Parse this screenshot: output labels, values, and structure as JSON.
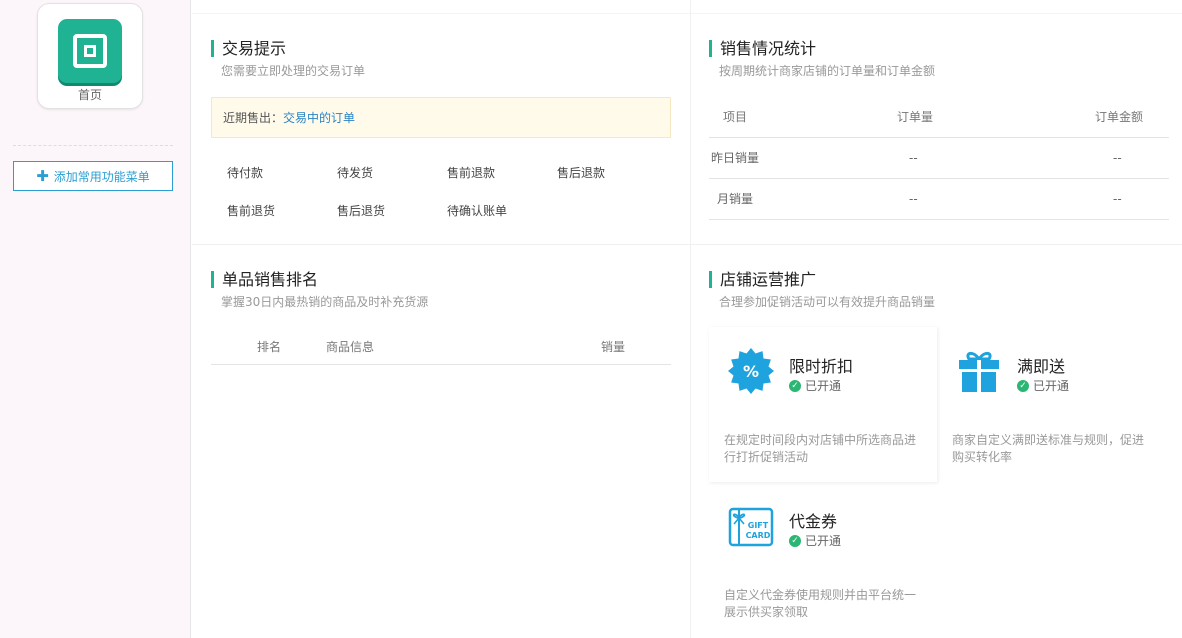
{
  "sidebar": {
    "home_label": "首页",
    "add_menu_label": "添加常用功能菜单"
  },
  "trade": {
    "title": "交易提示",
    "subtitle": "您需要立即处理的交易订单",
    "notice_prefix": "近期售出：",
    "notice_link": "交易中的订单",
    "links": [
      "待付款",
      "待发货",
      "售前退款",
      "售后退款",
      "售前退货",
      "售后退货",
      "待确认账单"
    ]
  },
  "sales": {
    "title": "销售情况统计",
    "subtitle": "按周期统计商家店铺的订单量和订单金额",
    "headers": [
      "项目",
      "订单量",
      "订单金额"
    ],
    "rows": [
      [
        "昨日销量",
        "--",
        "--"
      ],
      [
        "月销量",
        "--",
        "--"
      ]
    ]
  },
  "ranking": {
    "title": "单品销售排名",
    "subtitle": "掌握30日内最热销的商品及时补充货源",
    "headers": [
      "排名",
      "商品信息",
      "销量"
    ]
  },
  "promotion": {
    "title": "店铺运营推广",
    "subtitle": "合理参加促销活动可以有效提升商品销量",
    "cards": [
      {
        "name": "限时折扣",
        "status": "已开通",
        "desc": "在规定时间段内对店铺中所选商品进行打折促销活动",
        "icon": "discount-badge-icon"
      },
      {
        "name": "满即送",
        "status": "已开通",
        "desc": "商家自定义满即送标准与规则，促进购买转化率",
        "icon": "gift-box-icon"
      },
      {
        "name": "代金券",
        "status": "已开通",
        "desc": "自定义代金券使用规则并由平台统一展示供买家领取",
        "icon": "gift-card-icon"
      }
    ],
    "gift_card_text": [
      "GIFT",
      "CARD"
    ],
    "discount_text": "%"
  },
  "colors": {
    "accent_green": "#1fb394",
    "link_blue": "#2a84c6",
    "icon_blue": "#1ea3de",
    "status_green": "#2bb673"
  }
}
